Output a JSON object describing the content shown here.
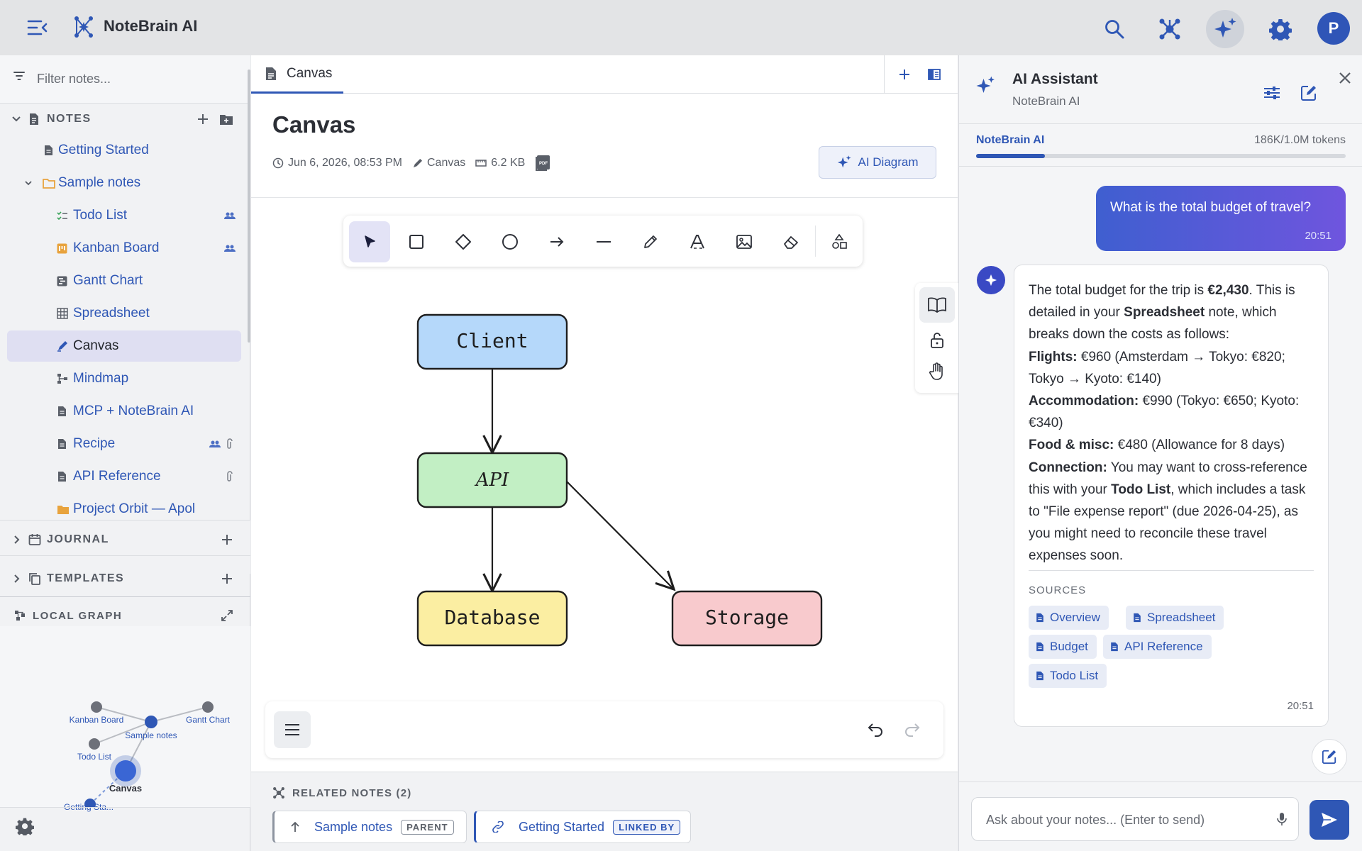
{
  "app": {
    "title": "NoteBrain AI",
    "avatar_initial": "P",
    "accent": "#2f57b5"
  },
  "sidebar": {
    "filter_placeholder": "Filter notes...",
    "sections": {
      "notes": "NOTES",
      "journal": "JOURNAL",
      "templates": "TEMPLATES",
      "local_graph": "LOCAL GRAPH"
    },
    "items": [
      {
        "label": "Getting Started",
        "icon": "note-icon"
      },
      {
        "label": "Sample notes",
        "icon": "folder-icon"
      },
      {
        "label": "Todo List",
        "icon": "checklist-icon"
      },
      {
        "label": "Kanban Board",
        "icon": "kanban-icon"
      },
      {
        "label": "Gantt Chart",
        "icon": "gantt-icon"
      },
      {
        "label": "Spreadsheet",
        "icon": "grid-icon"
      },
      {
        "label": "Canvas",
        "icon": "canvas-icon"
      },
      {
        "label": "Mindmap",
        "icon": "mindmap-icon"
      },
      {
        "label": "MCP + NoteBrain AI",
        "icon": "note-icon"
      },
      {
        "label": "Recipe",
        "icon": "note-icon"
      },
      {
        "label": "API Reference",
        "icon": "note-icon"
      },
      {
        "label": "Project Orbit — Apol",
        "icon": "folder-icon"
      }
    ],
    "graph_nodes": [
      "Kanban Board",
      "Sample notes",
      "Gantt Chart",
      "Todo List",
      "Canvas",
      "Getting Sta..."
    ]
  },
  "editor": {
    "tab_label": "Canvas",
    "title": "Canvas",
    "meta": {
      "date": "Jun 6, 2026, 08:53 PM",
      "type": "Canvas",
      "size": "6.2 KB"
    },
    "ai_diagram_label": "AI Diagram",
    "diagram_nodes": {
      "client": "Client",
      "api": "API",
      "database": "Database",
      "storage": "Storage"
    },
    "node_colors": {
      "client": "#b5d8fa",
      "api": "#c2efc4",
      "database": "#fbeea2",
      "storage": "#f8cacd"
    },
    "related": {
      "heading": "RELATED NOTES (2)",
      "items": [
        {
          "label": "Sample notes",
          "badge": "PARENT"
        },
        {
          "label": "Getting Started",
          "badge": "LINKED BY"
        }
      ]
    }
  },
  "assistant": {
    "title": "AI Assistant",
    "subtitle": "NoteBrain AI",
    "model_label": "NoteBrain AI",
    "tokens": "186K/1.0M tokens",
    "token_usage": 0.186,
    "user_message": "What is the total budget of travel?",
    "user_time": "20:51",
    "reply": {
      "p1a": "The total budget for the trip is ",
      "total": "€2,430",
      "p1b": ". This is detailed in your ",
      "spreadsheet": "Spreadsheet",
      "p1c": " note, which breaks down the costs as follows:",
      "flights_label": "Flights:",
      "flights": " €960 (Amsterdam → Tokyo: €820; Tokyo → Kyoto: €140)",
      "accommodation_label": "Accommodation:",
      "accommodation": " €990 (Tokyo: €650; Kyoto: €340)",
      "food_label": "Food & misc:",
      "food": " €480 (Allowance for 8 days)",
      "connection_label": "Connection:",
      "connection_a": " You may want to cross-reference this with your ",
      "todo": "Todo List",
      "connection_b": ", which includes a task to \"File expense report\" (due 2026-04-25), as you might need to reconcile these travel expenses soon."
    },
    "sources_heading": "SOURCES",
    "sources": [
      "Overview",
      "Spreadsheet",
      "Budget",
      "API Reference",
      "Todo List"
    ],
    "reply_time": "20:51",
    "input_placeholder": "Ask about your notes... (Enter to send)"
  }
}
